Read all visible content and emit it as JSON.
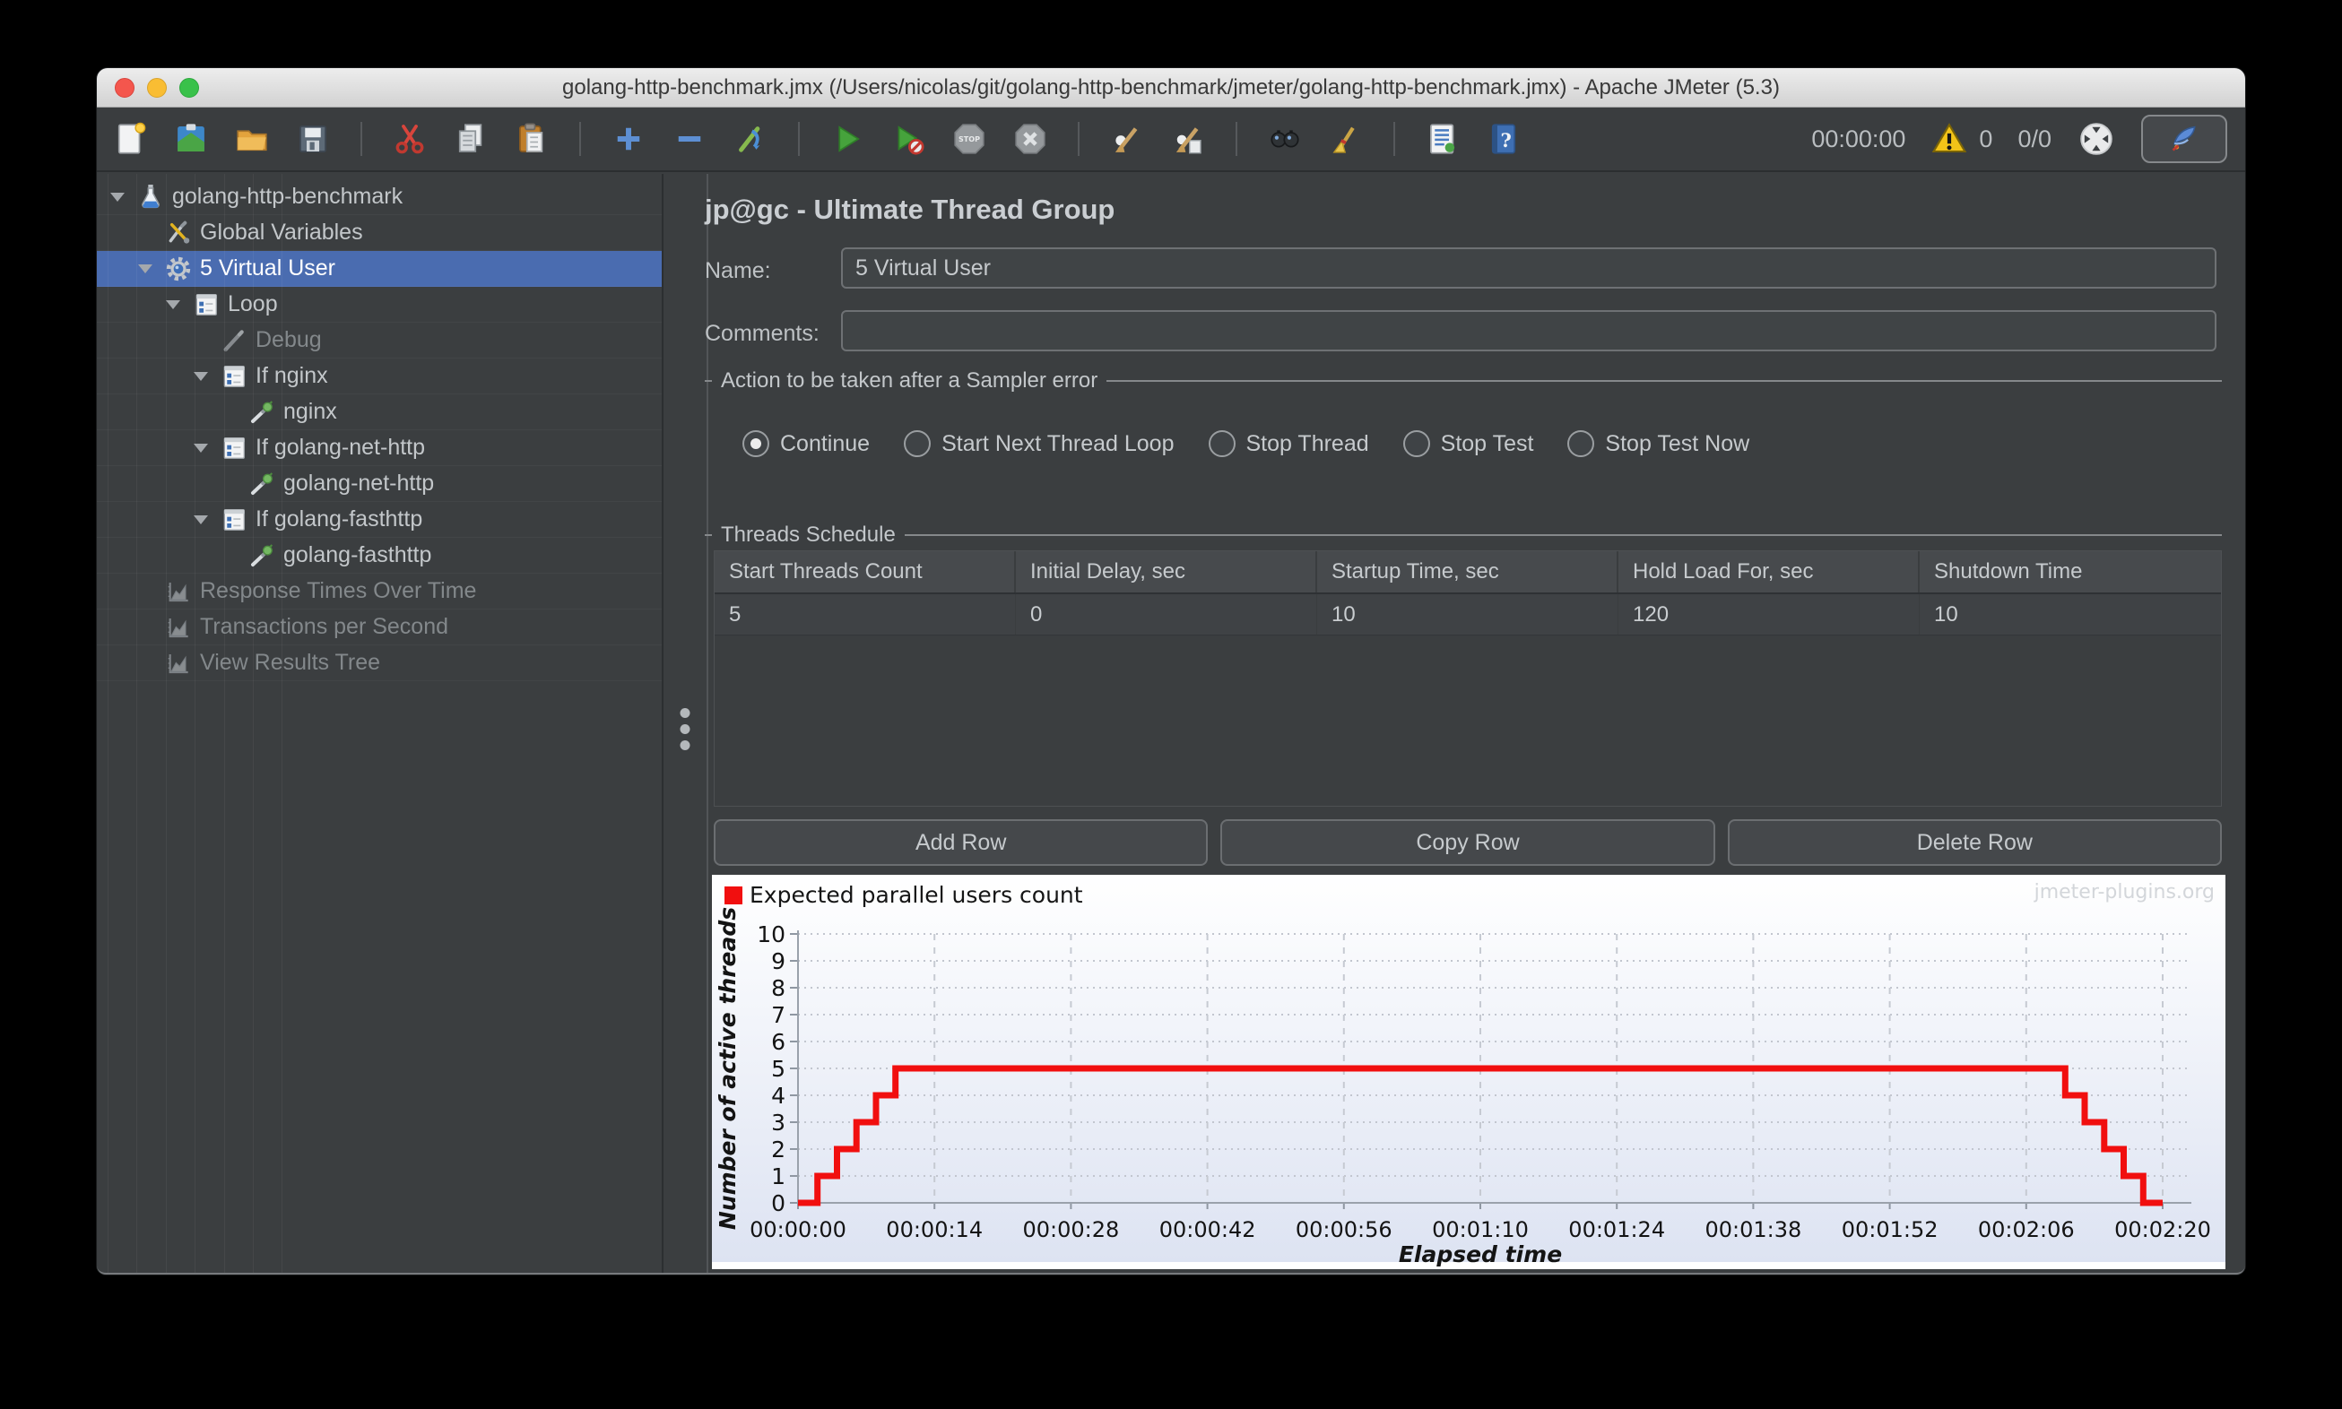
{
  "window": {
    "title": "golang-http-benchmark.jmx (/Users/nicolas/git/golang-http-benchmark/jmeter/golang-http-benchmark.jmx) - Apache JMeter (5.3)"
  },
  "toolbar": {
    "groups": [
      [
        "new",
        "templates",
        "open",
        "save"
      ],
      [
        "cut",
        "copy",
        "paste"
      ],
      [
        "zoom-in",
        "zoom-out",
        "toggle"
      ],
      [
        "start",
        "start-no-pauses",
        "stop",
        "shutdown"
      ],
      [
        "clean",
        "clean-all"
      ],
      [
        "search",
        "search-reset"
      ],
      [
        "function-helper",
        "help"
      ]
    ],
    "timer": "00:00:00",
    "warning_count": "0",
    "thread_count": "0/0",
    "right_icons": [
      "sphere",
      "feather"
    ]
  },
  "tree": {
    "items": [
      {
        "label": "golang-http-benchmark",
        "icon": "flask",
        "level": 0,
        "expander": true
      },
      {
        "label": "Global Variables",
        "icon": "toolkit",
        "level": 1
      },
      {
        "label": "5 Virtual User",
        "icon": "gear",
        "level": 1,
        "expander": true,
        "selected": true
      },
      {
        "label": "Loop",
        "icon": "controller",
        "level": 2,
        "expander": true
      },
      {
        "label": "Debug",
        "icon": "pencil",
        "level": 3,
        "disabled": true
      },
      {
        "label": "If nginx",
        "icon": "controller",
        "level": 3,
        "expander": true
      },
      {
        "label": "nginx",
        "icon": "dropper",
        "level": 4
      },
      {
        "label": "If golang-net-http",
        "icon": "controller",
        "level": 3,
        "expander": true
      },
      {
        "label": "golang-net-http",
        "icon": "dropper",
        "level": 4
      },
      {
        "label": "If golang-fasthttp",
        "icon": "controller",
        "level": 3,
        "expander": true
      },
      {
        "label": "golang-fasthttp",
        "icon": "dropper",
        "level": 4
      },
      {
        "label": "Response Times Over Time",
        "icon": "chart",
        "level": 1,
        "disabled": true
      },
      {
        "label": "Transactions per Second",
        "icon": "chart",
        "level": 1,
        "disabled": true
      },
      {
        "label": "View Results Tree",
        "icon": "chart",
        "level": 1,
        "disabled": true
      }
    ]
  },
  "main": {
    "title": "jp@gc - Ultimate Thread Group",
    "name_label": "Name:",
    "name_value": "5 Virtual User",
    "comments_label": "Comments:",
    "comments_value": "",
    "error_action": {
      "title": "Action to be taken after a Sampler error",
      "options": [
        {
          "label": "Continue",
          "selected": true
        },
        {
          "label": "Start Next Thread Loop",
          "selected": false
        },
        {
          "label": "Stop Thread",
          "selected": false
        },
        {
          "label": "Stop Test",
          "selected": false
        },
        {
          "label": "Stop Test Now",
          "selected": false
        }
      ]
    },
    "threads_schedule": {
      "title": "Threads Schedule",
      "columns": [
        "Start Threads Count",
        "Initial Delay, sec",
        "Startup Time, sec",
        "Hold Load For, sec",
        "Shutdown Time"
      ],
      "rows": [
        [
          "5",
          "0",
          "10",
          "120",
          "10"
        ]
      ]
    },
    "buttons": [
      "Add Row",
      "Copy Row",
      "Delete Row"
    ]
  },
  "chart_data": {
    "type": "line",
    "subtype": "step",
    "legend": "Expected parallel users count",
    "watermark": "jmeter-plugins.org",
    "xlabel": "Elapsed time",
    "ylabel": "Number of active threads",
    "line_color": "#f10f0f",
    "grid": true,
    "ylim": [
      0,
      10
    ],
    "yticks": [
      0,
      1,
      2,
      3,
      4,
      5,
      6,
      7,
      8,
      9,
      10
    ],
    "xlim": [
      0,
      140
    ],
    "xtick_seconds": [
      0,
      14,
      28,
      42,
      56,
      70,
      84,
      98,
      112,
      126,
      140
    ],
    "xtick_labels": [
      "00:00:00",
      "00:00:14",
      "00:00:28",
      "00:00:42",
      "00:00:56",
      "00:01:10",
      "00:01:24",
      "00:01:38",
      "00:01:52",
      "00:02:06",
      "00:02:20"
    ],
    "series": [
      {
        "name": "Expected parallel users count",
        "color": "#f10f0f",
        "points": [
          [
            0,
            0
          ],
          [
            2,
            0
          ],
          [
            2,
            1
          ],
          [
            4,
            1
          ],
          [
            4,
            2
          ],
          [
            6,
            2
          ],
          [
            6,
            3
          ],
          [
            8,
            3
          ],
          [
            8,
            4
          ],
          [
            10,
            4
          ],
          [
            10,
            5
          ],
          [
            130,
            5
          ],
          [
            130,
            4
          ],
          [
            132,
            4
          ],
          [
            132,
            3
          ],
          [
            134,
            3
          ],
          [
            134,
            2
          ],
          [
            136,
            2
          ],
          [
            136,
            1
          ],
          [
            138,
            1
          ],
          [
            138,
            0
          ],
          [
            140,
            0
          ]
        ]
      }
    ]
  }
}
